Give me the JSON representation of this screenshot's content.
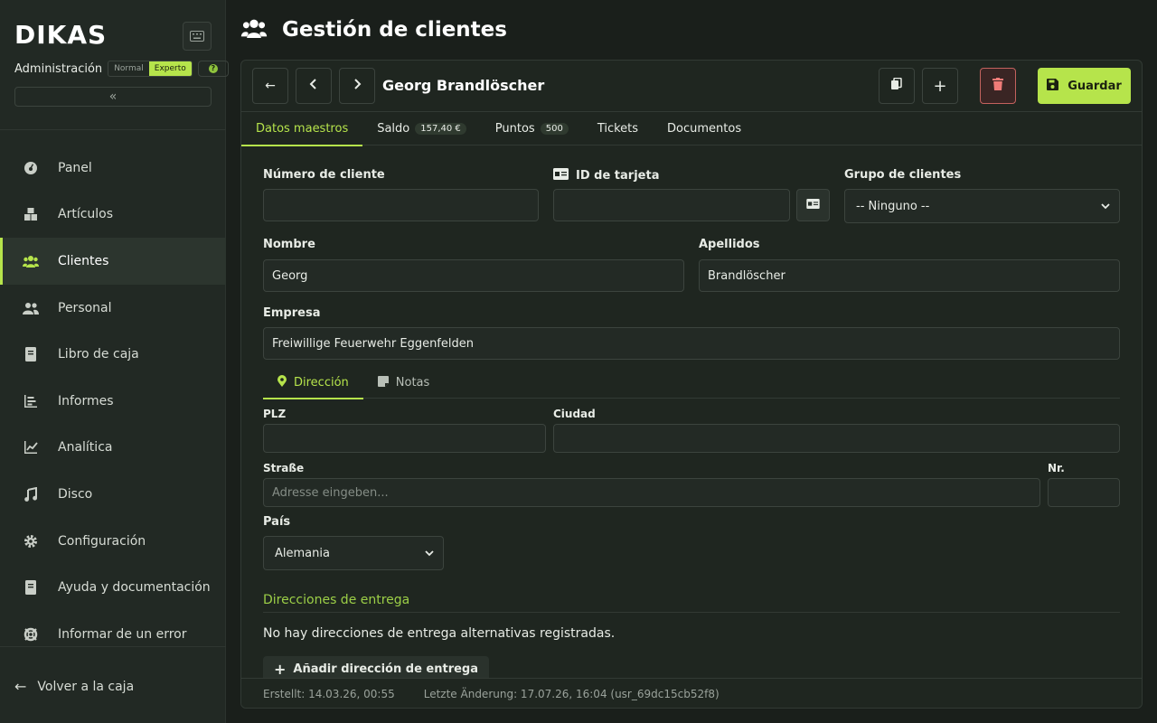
{
  "app": {
    "logo": "DIKAS",
    "mode_label": "Administración",
    "modes": [
      "Normal",
      "Experto"
    ],
    "active_mode": "Experto",
    "collapse_icon": "chevrons-left-icon"
  },
  "sidebar": {
    "items": [
      {
        "label": "Panel",
        "icon": "dashboard-icon"
      },
      {
        "label": "Artículos",
        "icon": "boxes-icon"
      },
      {
        "label": "Clientes",
        "icon": "users-icon",
        "active": true
      },
      {
        "label": "Personal",
        "icon": "staff-icon"
      },
      {
        "label": "Libro de caja",
        "icon": "book-icon"
      },
      {
        "label": "Informes",
        "icon": "report-icon"
      },
      {
        "label": "Analítica",
        "icon": "chart-icon"
      },
      {
        "label": "Disco",
        "icon": "music-icon"
      },
      {
        "label": "Configuración",
        "icon": "gear-icon"
      },
      {
        "label": "Ayuda y documentación",
        "icon": "help-book-icon"
      },
      {
        "label": "Informar de un error",
        "icon": "lifebuoy-icon"
      }
    ],
    "back_label": "Volver a la caja"
  },
  "header": {
    "title": "Gestión de clientes"
  },
  "record": {
    "title": "Georg Brandlöscher",
    "save_label": "Guardar"
  },
  "tabs": [
    {
      "label": "Datos maestros",
      "active": true
    },
    {
      "label": "Saldo",
      "badge": "157,40 €"
    },
    {
      "label": "Puntos",
      "badge": "500"
    },
    {
      "label": "Tickets"
    },
    {
      "label": "Documentos"
    }
  ],
  "form": {
    "customer_number_label": "Número de cliente",
    "customer_number_value": "",
    "card_id_label": "ID de tarjeta",
    "card_id_value": "",
    "group_label": "Grupo de clientes",
    "group_value": "-- Ninguno --",
    "first_name_label": "Nombre",
    "first_name_value": "Georg",
    "last_name_label": "Apellidos",
    "last_name_value": "Brandlöscher",
    "company_label": "Empresa",
    "company_value": "Freiwillige Feuerwehr Eggenfelden"
  },
  "subtabs": [
    {
      "label": "Dirección",
      "active": true
    },
    {
      "label": "Notas"
    }
  ],
  "address": {
    "plz_label": "PLZ",
    "plz_value": "",
    "city_label": "Ciudad",
    "city_value": "",
    "street_label": "Straße",
    "street_placeholder": "Adresse eingeben...",
    "number_label": "Nr.",
    "number_value": "",
    "country_label": "País",
    "country_value": "Alemania"
  },
  "delivery": {
    "title": "Direcciones de entrega",
    "empty_text": "No hay direcciones de entrega alternativas registradas.",
    "add_label": "Añadir dirección de entrega"
  },
  "footer": {
    "created": "Erstellt: 14.03.26, 00:55",
    "modified": "Letzte Änderung: 17.07.26, 16:04 (usr_69dc15cb52f8)"
  },
  "colors": {
    "accent": "#b6e44b",
    "background": "#1a1f1b",
    "danger": "#ef7b78"
  }
}
